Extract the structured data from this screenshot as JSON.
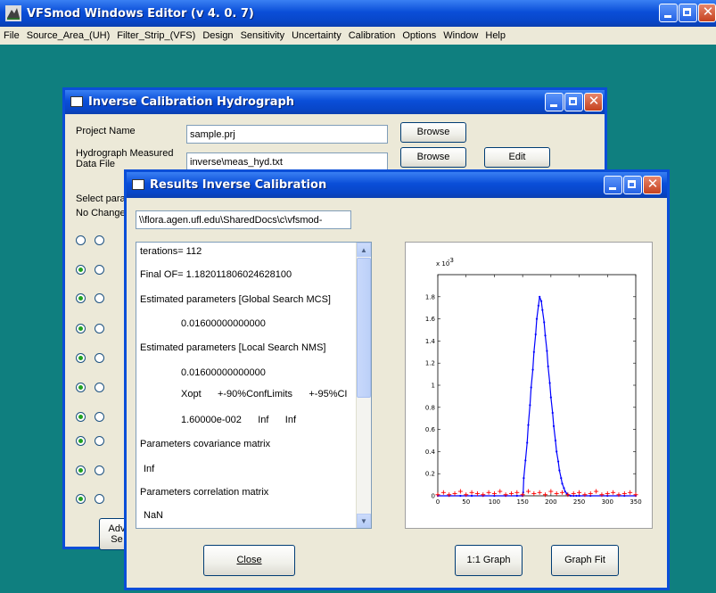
{
  "app": {
    "title": "VFSmod Windows Editor (v 4. 0. 7)"
  },
  "menu": [
    "File",
    "Source_Area_(UH)",
    "Filter_Strip_(VFS)",
    "Design",
    "Sensitivity",
    "Uncertainty",
    "Calibration",
    "Options",
    "Window",
    "Help"
  ],
  "hydro_dialog": {
    "title": "Inverse Calibration Hydrograph",
    "project_name_label": "Project Name",
    "project_name_value": "sample.prj",
    "data_file_label_1": "Hydrograph Measured",
    "data_file_label_2": "Data File",
    "data_file_value": "inverse\\meas_hyd.txt",
    "browse_label": "Browse",
    "edit_label": "Edit",
    "select_label": "Select para",
    "nochange_label": "No Change",
    "adv_label_1": "Adv",
    "adv_label_2": "Se",
    "radio_rows": [
      {
        "left": false,
        "right": false
      },
      {
        "left": true,
        "right": false
      },
      {
        "left": true,
        "right": false
      },
      {
        "left": true,
        "right": false
      },
      {
        "left": true,
        "right": false
      },
      {
        "left": true,
        "right": false
      },
      {
        "left": true,
        "right": false
      },
      {
        "left": true,
        "right": false
      },
      {
        "left": true,
        "right": false
      },
      {
        "left": true,
        "right": false
      }
    ]
  },
  "results_dialog": {
    "title": "Results Inverse Calibration",
    "path": "\\\\flora.agen.ufl.edu\\SharedDocs\\c\\vfsmod-",
    "lines": [
      "terations= 112",
      "Final OF= 1.182011806024628100",
      "Estimated parameters [Global Search MCS]",
      "0.01600000000000",
      "Estimated parameters [Local Search NMS]",
      "0.01600000000000",
      "Xopt      +-90%ConfLimits      +-95%CI",
      "1.60000e-002      Inf      Inf",
      "Parameters covariance matrix",
      "Inf",
      "Parameters correlation matrix",
      "NaN"
    ],
    "close_label": "Close",
    "graph11_label": "1:1 Graph",
    "graphfit_label": "Graph Fit"
  },
  "chart_data": {
    "type": "line",
    "exponent_label": "x 10",
    "exponent_power": "-3",
    "xlim": [
      0,
      350
    ],
    "ylim": [
      0,
      0.002
    ],
    "xticks": [
      0,
      50,
      100,
      150,
      200,
      250,
      300,
      350
    ],
    "xtick_labels": [
      "0",
      "50",
      "100",
      "150",
      "200",
      "250",
      "300",
      "350"
    ],
    "yticks": [
      0,
      0.0002,
      0.0004,
      0.0006,
      0.0008,
      0.001,
      0.0012,
      0.0014,
      0.0016,
      0.0018
    ],
    "ytick_labels": [
      "0",
      "0.2",
      "0.4",
      "0.6",
      "0.8",
      "1",
      "1.2",
      "1.4",
      "1.6",
      "1.8"
    ],
    "series": [
      {
        "color": "#0000ff",
        "marker": "dot",
        "x": [
          0,
          20,
          40,
          60,
          80,
          100,
          120,
          140,
          150,
          151,
          152,
          155,
          158,
          160,
          163,
          165,
          168,
          170,
          173,
          175,
          178,
          180,
          183,
          185,
          188,
          190,
          193,
          195,
          198,
          200,
          203,
          205,
          208,
          210,
          213,
          215,
          218,
          220,
          223,
          225,
          228,
          230,
          235,
          240,
          245,
          250,
          270,
          300,
          330,
          350
        ],
        "y": [
          0,
          0,
          0,
          0,
          0,
          0,
          0,
          0,
          0,
          3e-05,
          0.00016,
          0.00032,
          0.00048,
          0.00064,
          0.00082,
          0.00098,
          0.00114,
          0.0013,
          0.00146,
          0.0016,
          0.00172,
          0.0018,
          0.00176,
          0.00168,
          0.00157,
          0.00145,
          0.00131,
          0.00117,
          0.00102,
          0.00089,
          0.00075,
          0.00063,
          0.0005,
          0.0004,
          0.00031,
          0.00023,
          0.00016,
          0.00011,
          7e-05,
          4e-05,
          2e-05,
          1e-05,
          0,
          0,
          0,
          0,
          0,
          0,
          0,
          0
        ]
      },
      {
        "color": "#ff0000",
        "marker": "plus",
        "x": [
          0,
          10,
          20,
          30,
          40,
          50,
          60,
          70,
          80,
          90,
          100,
          110,
          120,
          130,
          140,
          150,
          160,
          170,
          180,
          190,
          200,
          210,
          220,
          230,
          240,
          250,
          260,
          270,
          280,
          290,
          300,
          310,
          320,
          330,
          340,
          350
        ],
        "y": [
          1e-05,
          3e-05,
          1e-05,
          2e-05,
          4e-05,
          1e-05,
          3e-05,
          2e-05,
          1e-05,
          3e-05,
          2e-05,
          4e-05,
          1e-05,
          2e-05,
          3e-05,
          1e-05,
          4e-05,
          2e-05,
          3e-05,
          1e-05,
          4e-05,
          2e-05,
          3e-05,
          1e-05,
          2e-05,
          3e-05,
          1e-05,
          2e-05,
          4e-05,
          1e-05,
          2e-05,
          3e-05,
          1e-05,
          2e-05,
          3e-05,
          1e-05
        ]
      }
    ]
  }
}
